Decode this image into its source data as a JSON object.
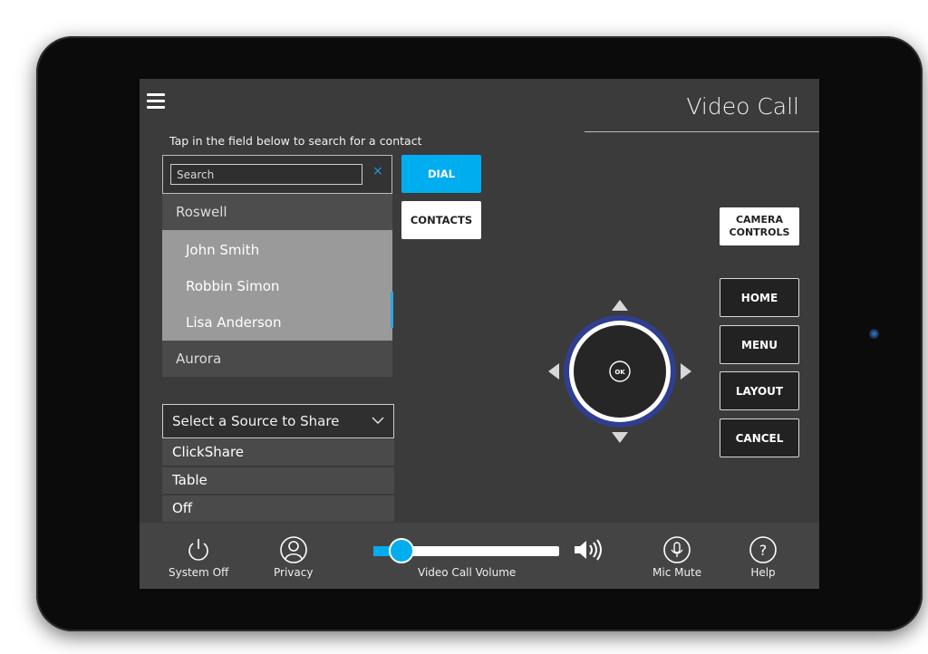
{
  "header": {
    "title": "Video Call"
  },
  "search": {
    "hint": "Tap in the field below to search for a contact",
    "placeholder": "Search",
    "clear_glyph": "×"
  },
  "contacts_dropdown": {
    "groups": [
      {
        "label": "Roswell",
        "items": [
          "John Smith",
          "Robbin Simon",
          "Lisa Anderson"
        ]
      },
      {
        "label": "Aurora",
        "items": []
      }
    ]
  },
  "buttons": {
    "dial": "DIAL",
    "contacts": "CONTACTS",
    "camera_line1": "CAMERA",
    "camera_line2": "CONTROLS",
    "home": "HOME",
    "menu": "MENU",
    "layout": "LAYOUT",
    "cancel": "CANCEL"
  },
  "dpad": {
    "ok_label": "OK"
  },
  "share": {
    "select_label": "Select a Source to Share",
    "options": [
      "ClickShare",
      "Table",
      "Off"
    ]
  },
  "footer": {
    "system_off": "System Off",
    "privacy": "Privacy",
    "volume_label": "Video Call Volume",
    "volume_level": 0.15,
    "mic_mute": "Mic Mute",
    "help": "Help"
  },
  "colors": {
    "accent": "#00aeef",
    "screen_bg": "#3b3b3b",
    "dpad_ring": "#2f3e8f"
  },
  "icons": [
    "menu-icon",
    "close-icon",
    "chevron-down-icon",
    "power-icon",
    "user-icon",
    "speaker-icon",
    "microphone-icon",
    "help-icon"
  ]
}
